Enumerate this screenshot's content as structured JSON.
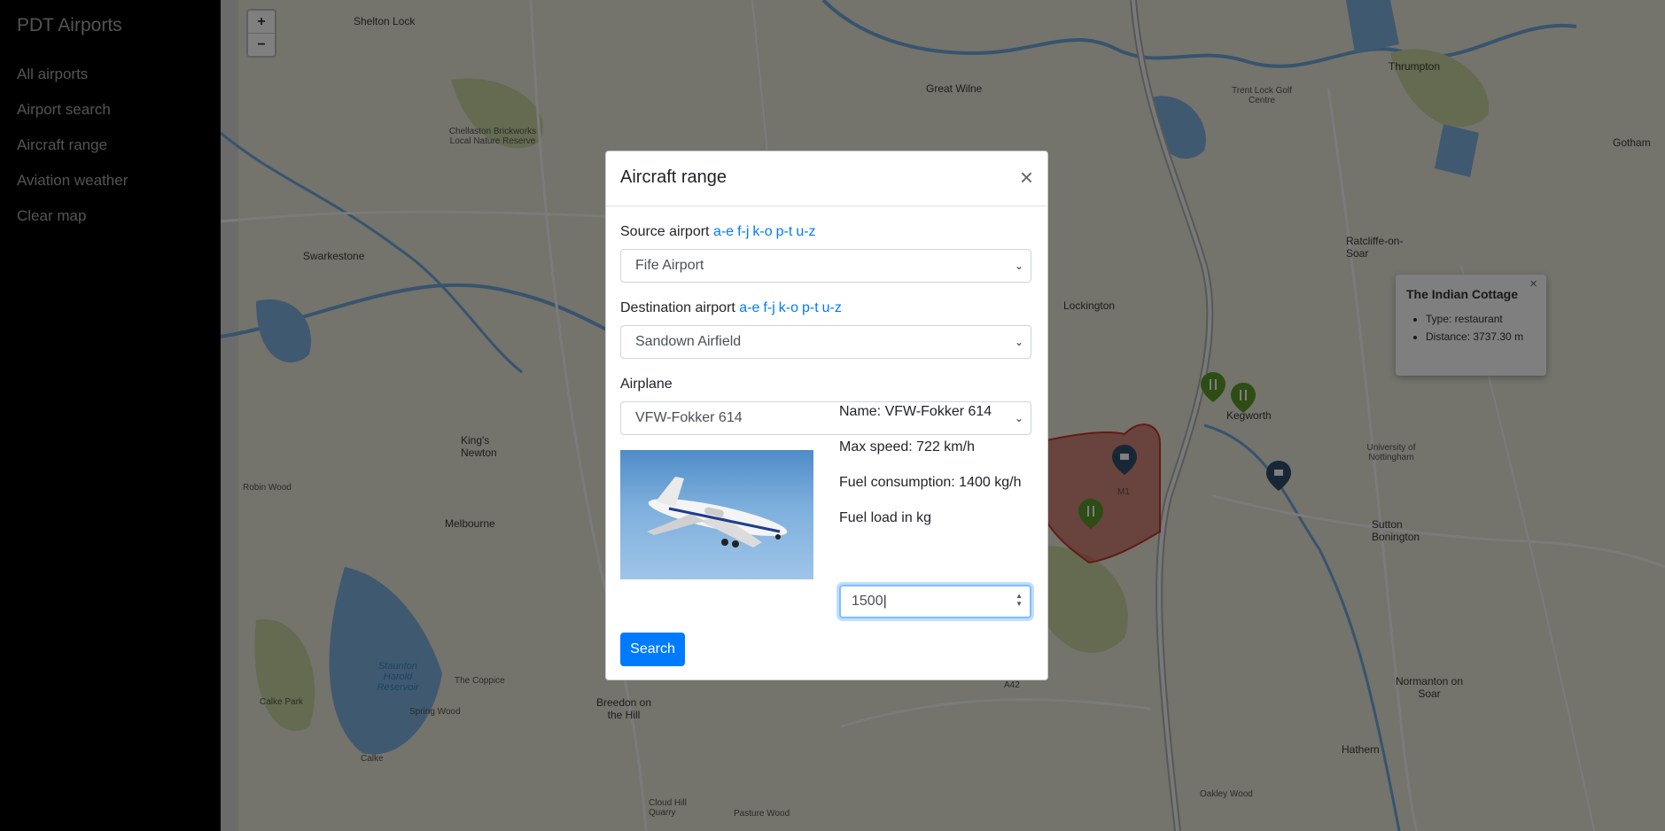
{
  "app": {
    "brand": "PDT Airports"
  },
  "sidebar": {
    "items": [
      {
        "label": "All airports"
      },
      {
        "label": "Airport search"
      },
      {
        "label": "Aircraft range"
      },
      {
        "label": "Aviation weather"
      },
      {
        "label": "Clear map"
      }
    ]
  },
  "map": {
    "zoom_in": "+",
    "zoom_out": "−",
    "labels": {
      "shelton_lock": "Shelton Lock",
      "great_wilne": "Great Wilne",
      "thrumpton": "Thrumpton",
      "gotham": "Gotham",
      "swarkestone": "Swarkestone",
      "ratcliffe": "Ratcliffe-on-Soar",
      "lockington": "Lockington",
      "kings_newton": "King's Newton",
      "melbourne": "Melbourne",
      "robin_wood": "Robin Wood",
      "breedon": "Breedon on the Hill",
      "sutton_bonington": "Sutton Bonington",
      "normanton": "Normanton on Soar",
      "hathern": "Hathern",
      "calke_park": "Calke Park",
      "calke": "Calke",
      "spring_wood": "Spring Wood",
      "the_coppice": "The Coppice",
      "staunton_harold": "Staunton Harold Reservoir",
      "kegworth": "Kegworth",
      "trent_lock": "Trent Lock Golf Centre",
      "pasture_wood": "Pasture Wood",
      "oakley_wood": "Oakley Wood",
      "cloud_hill": "Cloud Hill Quarry",
      "chellaston": "Chellaston Brickworks Local Nature Reserve",
      "uni_nottingham": "University of Nottingham",
      "m1": "M1",
      "a42": "A42"
    },
    "popup": {
      "title": "The Indian Cottage",
      "close": "×",
      "type": "Type: restaurant",
      "distance": "Distance: 3737.30 m"
    }
  },
  "modal": {
    "title": "Aircraft range",
    "close": "×",
    "source_label": "Source airport",
    "destination_label": "Destination airport",
    "letter_groups": [
      "a-e",
      "f-j",
      "k-o",
      "p-t",
      "u-z"
    ],
    "source_value": "Fife Airport",
    "destination_value": "Sandown Airfield",
    "airplane_label": "Airplane",
    "airplane_value": "VFW-Fokker 614",
    "info_name": "Name: VFW-Fokker 614",
    "info_speed": "Max speed: 722 km/h",
    "info_fuel": "Fuel consumption: 1400 kg/h",
    "fuel_label": "Fuel load in kg",
    "fuel_value": "1500",
    "search_label": "Search"
  },
  "colors": {
    "accent": "#007bff",
    "sidebar_bg": "#000000",
    "map_water": "#3b87c9",
    "marker_green": "#5a9a2a",
    "marker_blue": "#2e4f6a",
    "range_area": "#c0392b"
  },
  "icons": {
    "select_caret": "chevron-down-icon",
    "spinner": "spinner-icon",
    "restaurant": "restaurant-marker-icon",
    "cafe": "cafe-marker-icon"
  }
}
